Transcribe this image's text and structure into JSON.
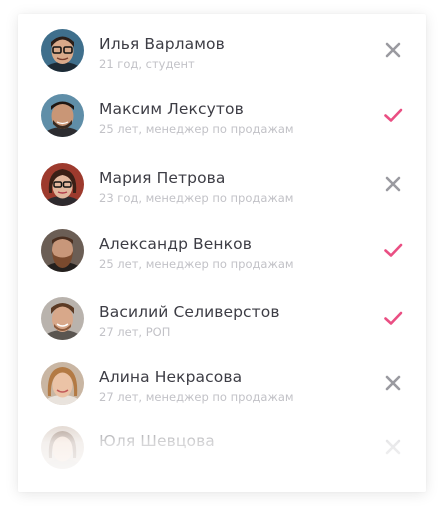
{
  "colors": {
    "accept": "#ea4f83",
    "reject": "#9a9aa0",
    "name": "#3d3d45",
    "subtitle": "#c2c2c7"
  },
  "people": [
    {
      "name": "Илья Варламов",
      "subtitle": "21 год, студент",
      "status": "rejected",
      "status_icon": "close-icon"
    },
    {
      "name": "Максим Лексутов",
      "subtitle": "25 лет, менеджер по продажам",
      "status": "accepted",
      "status_icon": "check-icon"
    },
    {
      "name": "Мария Петрова",
      "subtitle": "23 год, менеджер по продажам",
      "status": "rejected",
      "status_icon": "close-icon"
    },
    {
      "name": "Александр Венков",
      "subtitle": "25 лет, менеджер по продажам",
      "status": "accepted",
      "status_icon": "check-icon"
    },
    {
      "name": "Василий Селиверстов",
      "subtitle": "27 лет, РОП",
      "status": "accepted",
      "status_icon": "check-icon"
    },
    {
      "name": "Алина Некрасова",
      "subtitle": "27 лет, менеджер по продажам",
      "status": "rejected",
      "status_icon": "close-icon"
    },
    {
      "name": "Юля Шевцова",
      "subtitle": "",
      "status": "rejected",
      "status_icon": "close-icon"
    }
  ]
}
